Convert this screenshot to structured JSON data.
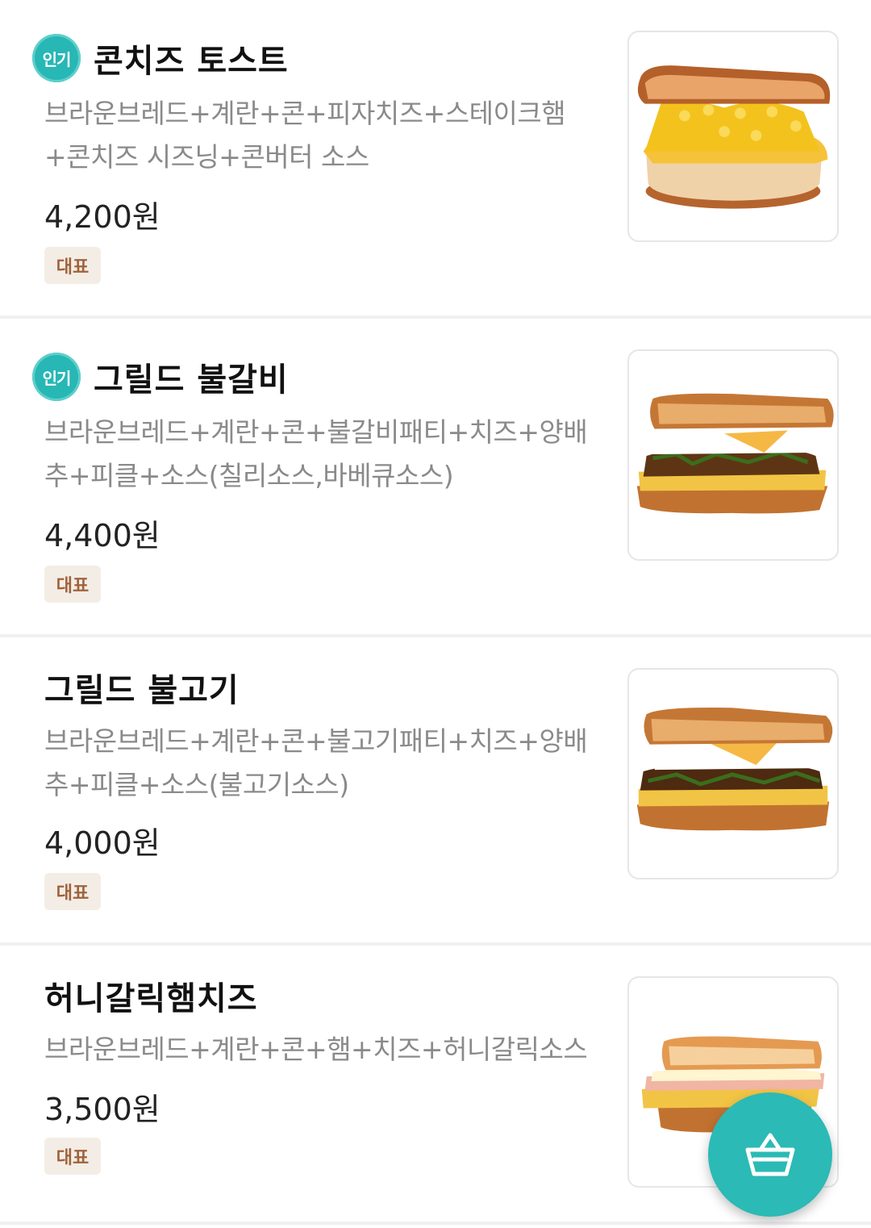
{
  "colors": {
    "accent": "#2bbab5",
    "popular_badge": "#27b7b5",
    "rep_badge_bg": "#f3ede6",
    "rep_badge_text": "#a0623a",
    "desc_text": "#8a8a8a"
  },
  "menu": {
    "items": [
      {
        "popular_label": "인기",
        "name": "콘치즈 토스트",
        "description": "브라운브레드+계란+콘+피자치즈+스테이크햄+콘치즈 시즈닝+콘버터 소스",
        "price": "4,200원",
        "badge": "대표",
        "image_icon": "corn-cheese-toast-image"
      },
      {
        "popular_label": "인기",
        "name": "그릴드 불갈비",
        "description": "브라운브레드+계란+콘+불갈비패티+치즈+양배추+피클+소스(칠리소스,바베큐소스)",
        "price": "4,400원",
        "badge": "대표",
        "image_icon": "grilled-bulgalbi-image"
      },
      {
        "name": "그릴드 불고기",
        "description": "브라운브레드+계란+콘+불고기패티+치즈+양배추+피클+소스(불고기소스)",
        "price": "4,000원",
        "badge": "대표",
        "image_icon": "grilled-bulgogi-image"
      },
      {
        "name": "허니갈릭햄치즈",
        "description": "브라운브레드+계란+콘+햄+치즈+허니갈릭소스",
        "price": "3,500원",
        "badge": "대표",
        "image_icon": "honey-garlic-ham-cheese-image"
      }
    ]
  },
  "cart_button": {
    "icon": "basket-icon"
  }
}
